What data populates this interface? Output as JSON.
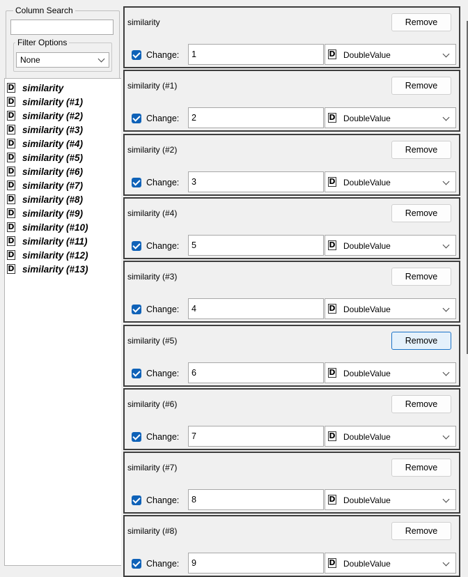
{
  "left": {
    "column_search_label": "Column Search",
    "search_value": "",
    "filter_label": "Filter Options",
    "filter_value": "None",
    "columns": [
      "similarity",
      "similarity (#1)",
      "similarity (#2)",
      "similarity (#3)",
      "similarity (#4)",
      "similarity (#5)",
      "similarity (#6)",
      "similarity (#7)",
      "similarity (#8)",
      "similarity (#9)",
      "similarity (#10)",
      "similarity (#11)",
      "similarity (#12)",
      "similarity (#13)"
    ],
    "type_badge": "D"
  },
  "panels": [
    {
      "title": "similarity",
      "value": "1",
      "type": "DoubleValue",
      "remove": "Remove",
      "change": "Change:",
      "focused": true
    },
    {
      "title": "similarity (#1)",
      "value": "2",
      "type": "DoubleValue",
      "remove": "Remove",
      "change": "Change:"
    },
    {
      "title": "similarity (#2)",
      "value": "3",
      "type": "DoubleValue",
      "remove": "Remove",
      "change": "Change:"
    },
    {
      "title": "similarity (#4)",
      "value": "5",
      "type": "DoubleValue",
      "remove": "Remove",
      "change": "Change:"
    },
    {
      "title": "similarity (#3)",
      "value": "4",
      "type": "DoubleValue",
      "remove": "Remove",
      "change": "Change:"
    },
    {
      "title": "similarity (#5)",
      "value": "6",
      "type": "DoubleValue",
      "remove": "Remove",
      "change": "Change:",
      "remove_hovered": true
    },
    {
      "title": "similarity (#6)",
      "value": "7",
      "type": "DoubleValue",
      "remove": "Remove",
      "change": "Change:"
    },
    {
      "title": "similarity (#7)",
      "value": "8",
      "type": "DoubleValue",
      "remove": "Remove",
      "change": "Change:"
    },
    {
      "title": "similarity (#8)",
      "value": "9",
      "type": "DoubleValue",
      "remove": "Remove",
      "change": "Change:"
    }
  ],
  "colors": {
    "checkbox": "#0f62b8",
    "panel_border": "#3d3d3d",
    "hover_border": "#1a73c9"
  }
}
